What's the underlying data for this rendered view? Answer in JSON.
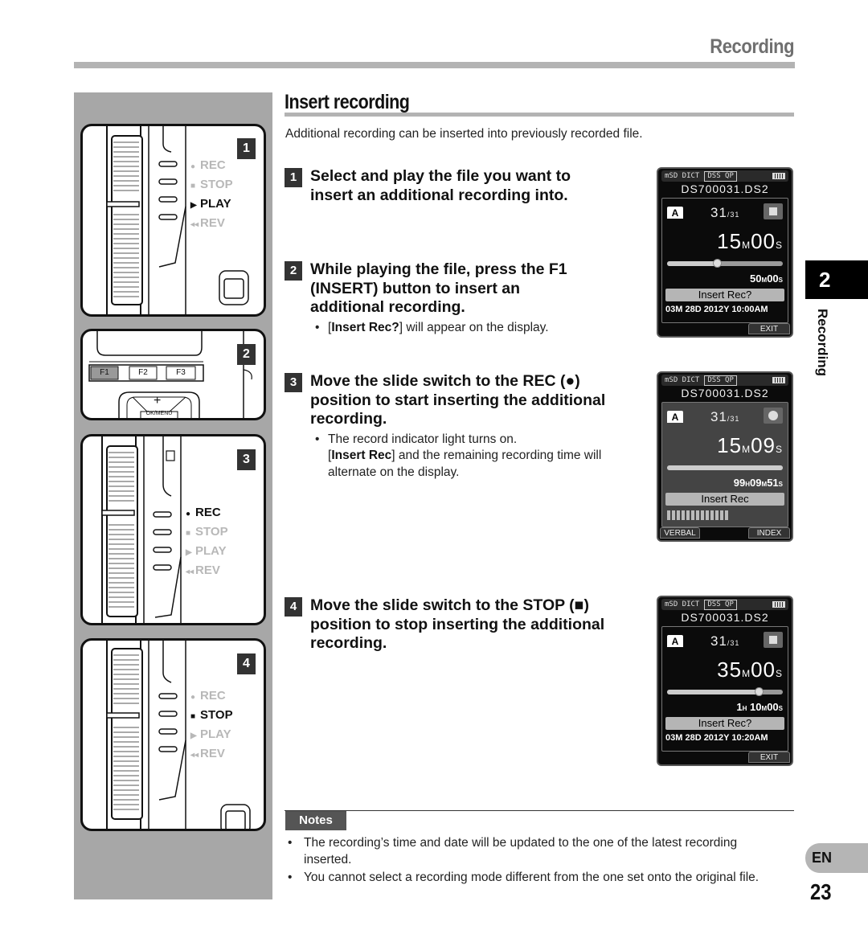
{
  "header": {
    "title": "Recording"
  },
  "section": {
    "title": "Insert recording",
    "intro": "Additional recording can be inserted into previously recorded file."
  },
  "steps": [
    {
      "number": "1",
      "text": "Select and play the file you want to insert an additional recording into.",
      "bullets": []
    },
    {
      "number": "2",
      "text": "While playing the file, press the F1 (INSERT) button to insert an additional recording.",
      "bullets": [
        {
          "bold": "Insert Rec?",
          "before": "[",
          "after": "] will appear on the display."
        }
      ]
    },
    {
      "number": "3",
      "text": "Move the slide switch to the REC (●) position to start inserting the additional recording.",
      "bullets": [
        {
          "line1": "The record indicator light turns on.",
          "bold": "Insert Rec",
          "before": "[",
          "after": "] and the remaining recording time will alternate on the display."
        }
      ]
    },
    {
      "number": "4",
      "text": "Move the slide switch to the STOP (■) position to stop inserting the additional recording.",
      "bullets": []
    }
  ],
  "illustrations": [
    {
      "badge": "1",
      "positions": [
        {
          "glyph": "●",
          "label": "REC",
          "active": false
        },
        {
          "glyph": "■",
          "label": "STOP",
          "active": false
        },
        {
          "glyph": "▶",
          "label": "PLAY",
          "active": true
        },
        {
          "glyph": "◂◂",
          "label": "REV",
          "active": false
        }
      ]
    },
    {
      "badge": "2",
      "buttons": [
        "F1",
        "F2",
        "F3"
      ],
      "nav_label": "OK/MENU",
      "plus": "+",
      "highlighted": "F1"
    },
    {
      "badge": "3",
      "positions": [
        {
          "glyph": "●",
          "label": "REC",
          "active": true
        },
        {
          "glyph": "■",
          "label": "STOP",
          "active": false
        },
        {
          "glyph": "▶",
          "label": "PLAY",
          "active": false
        },
        {
          "glyph": "◂◂",
          "label": "REV",
          "active": false
        }
      ]
    },
    {
      "badge": "4",
      "positions": [
        {
          "glyph": "●",
          "label": "REC",
          "active": false
        },
        {
          "glyph": "■",
          "label": "STOP",
          "active": true
        },
        {
          "glyph": "▶",
          "label": "PLAY",
          "active": false
        },
        {
          "glyph": "◂◂",
          "label": "REV",
          "active": false
        }
      ]
    }
  ],
  "screens": [
    {
      "topbar": "mSD DICT",
      "mode1": "DSS",
      "mode2": "QP",
      "filename": "DS700031.DS2",
      "folder": "A",
      "file_index": "31",
      "file_total": "/31",
      "state": "stop",
      "time_main": "15",
      "time_main_unit": "M",
      "time_sec": "00",
      "time_sec_unit": "S",
      "progress": 0.43,
      "sub_time": "50ₘ00ₛ",
      "sub_h": "",
      "sub_m": "50",
      "sub_s": "00",
      "message": "Insert Rec?",
      "datetime": "03M 28D 2012Y 10:00AM",
      "softkey_left": "",
      "softkey_right": "EXIT"
    },
    {
      "topbar": "mSD DICT",
      "mode1": "DSS",
      "mode2": "QP",
      "filename": "DS700031.DS2",
      "folder": "A",
      "file_index": "31",
      "file_total": "/31",
      "state": "rec",
      "time_main": "15",
      "time_main_unit": "M",
      "time_sec": "09",
      "time_sec_unit": "S",
      "progress": 1.0,
      "sub_h": "99",
      "sub_m": "09",
      "sub_s": "51",
      "message": "Insert Rec",
      "datetime": "",
      "softkey_left": "VERBAL",
      "softkey_right": "INDEX"
    },
    {
      "topbar": "mSD DICT",
      "mode1": "DSS",
      "mode2": "QP",
      "filename": "DS700031.DS2",
      "folder": "A",
      "file_index": "31",
      "file_total": "/31",
      "state": "stop",
      "time_main": "35",
      "time_main_unit": "M",
      "time_sec": "00",
      "time_sec_unit": "S",
      "progress": 0.79,
      "sub_h": "1",
      "sub_m": "10",
      "sub_s": "00",
      "message": "Insert Rec?",
      "datetime": "03M 28D 2012Y 10:20AM",
      "softkey_left": "",
      "softkey_right": "EXIT"
    }
  ],
  "side": {
    "chapter_number": "2",
    "chapter_label": "Recording",
    "language": "EN",
    "page_number": "23"
  },
  "notes": {
    "label": "Notes",
    "items": [
      "The recording’s time and date will be updated to the one of the latest recording inserted.",
      "You cannot select a recording mode different from the one set onto the original file."
    ]
  }
}
